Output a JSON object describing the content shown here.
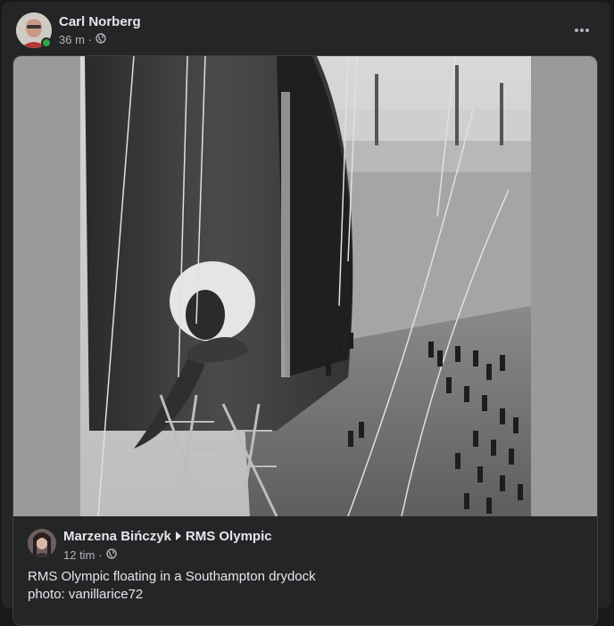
{
  "post": {
    "author": "Carl Norberg",
    "time": "36 m",
    "separator": "·",
    "audience_icon": "globe-icon",
    "more_icon": "more-horizontal-icon",
    "online": true
  },
  "shared": {
    "photo_alt": "RMS Olympic floating in a Southampton drydock",
    "original": {
      "author": "Marzena Bińczyk",
      "arrow_icon": "triangle-right-icon",
      "target": "RMS Olympic",
      "time": "12 tim",
      "separator": "·",
      "audience_icon": "globe-icon",
      "caption_line1": "RMS Olympic floating in a Southampton drydock",
      "caption_line2": "photo: vanillarice72"
    }
  },
  "colors": {
    "background": "#18191a",
    "card": "#242526",
    "text_primary": "#e4e6eb",
    "text_secondary": "#b0b3b8",
    "online": "#31a24c"
  }
}
